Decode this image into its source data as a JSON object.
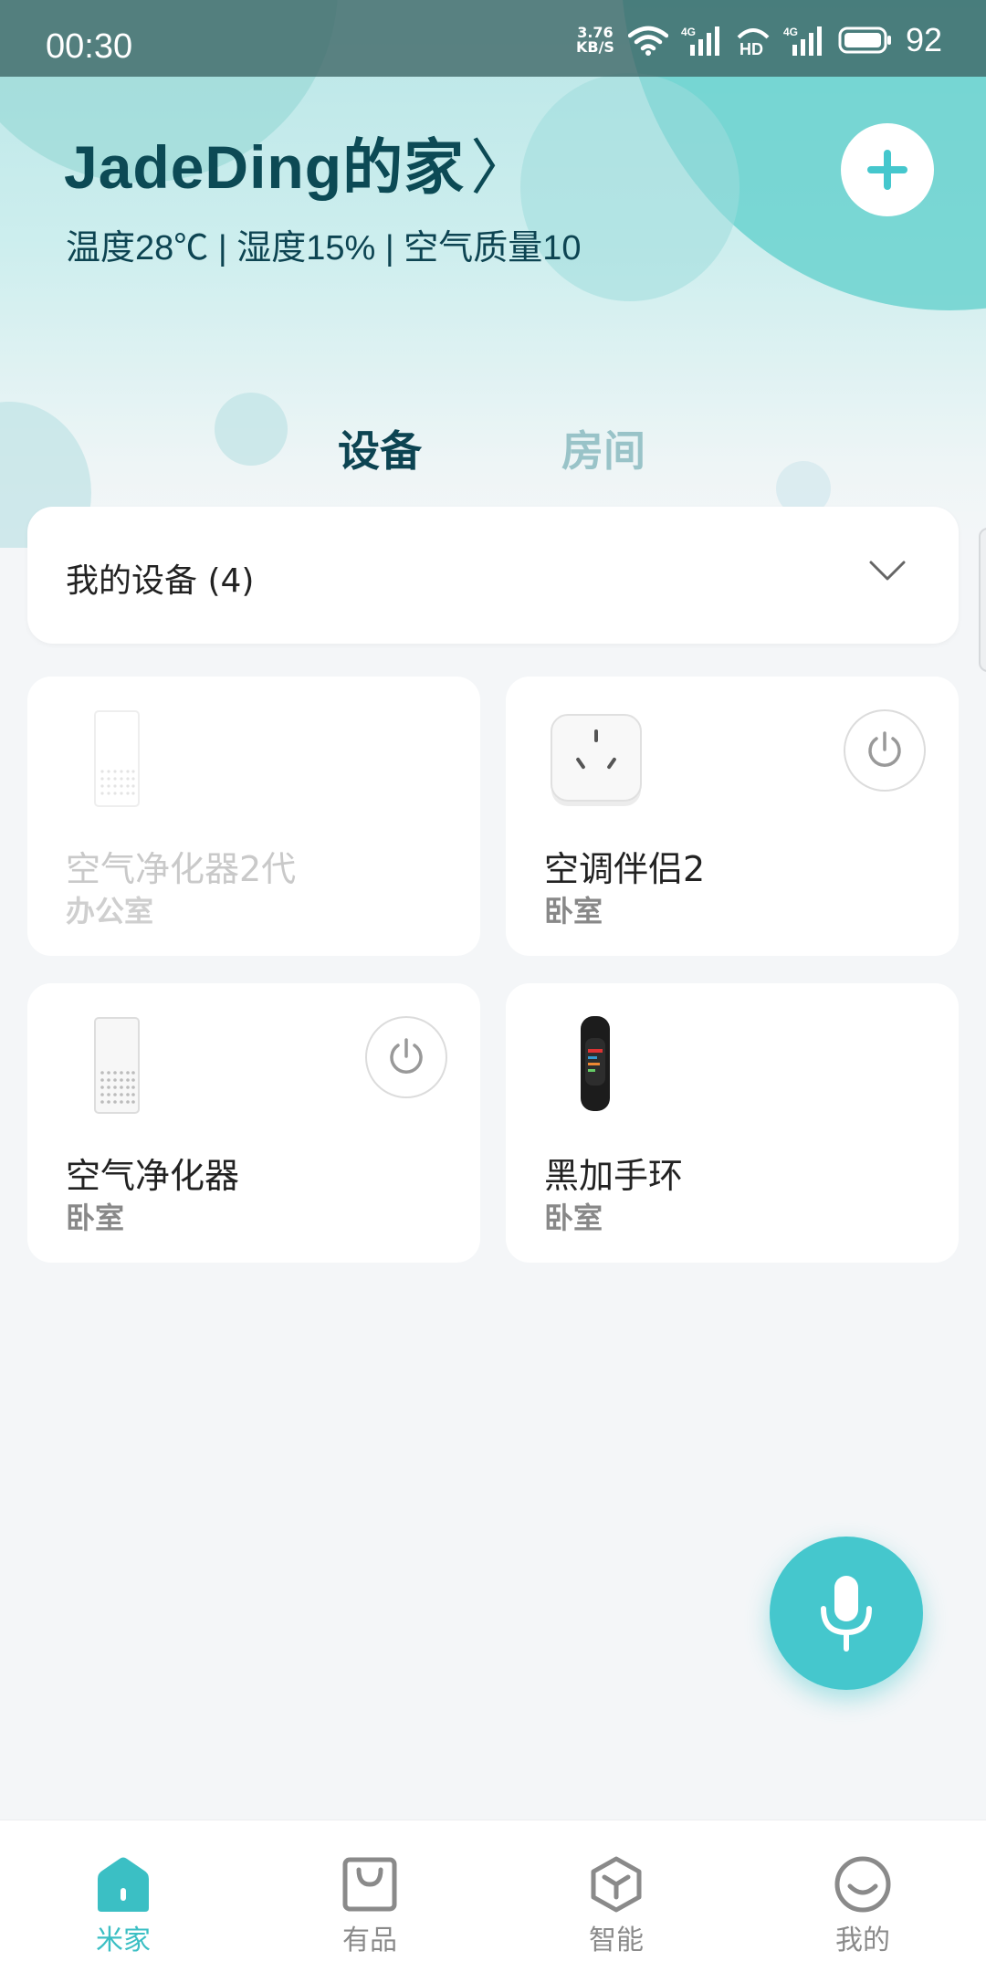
{
  "status_bar": {
    "time": "00:30",
    "net_speed_value": "3.76",
    "net_speed_unit": "KB/S",
    "signal_1_label": "4G",
    "hd_label": "HD",
    "signal_2_label": "4G",
    "battery": "92"
  },
  "home": {
    "title": "JadeDing的家",
    "arrow": "〉",
    "stats": "温度28℃ | 湿度15% | 空气质量10"
  },
  "tabs": [
    {
      "label": "设备",
      "active": true
    },
    {
      "label": "房间",
      "active": false
    }
  ],
  "section": {
    "label": "我的设备 (4)"
  },
  "devices": [
    {
      "name": "空气净化器2代",
      "room": "办公室",
      "online": false,
      "icon": "air-purifier-icon"
    },
    {
      "name": "空调伴侣2",
      "room": "卧室",
      "online": true,
      "icon": "ac-companion-icon"
    },
    {
      "name": "空气净化器",
      "room": "卧室",
      "online": true,
      "icon": "air-purifier-icon"
    },
    {
      "name": "黑加手环",
      "room": "卧室",
      "online": true,
      "icon": "fitness-band-icon"
    }
  ],
  "bottom_nav": [
    {
      "label": "米家",
      "icon": "home-icon",
      "active": true
    },
    {
      "label": "有品",
      "icon": "shopping-bag-icon",
      "active": false
    },
    {
      "label": "智能",
      "icon": "cube-icon",
      "active": false
    },
    {
      "label": "我的",
      "icon": "smiley-icon",
      "active": false
    }
  ],
  "colors": {
    "accent": "#45c7cd",
    "title": "#0c4a55",
    "inactive_tab": "#99c3c8"
  }
}
